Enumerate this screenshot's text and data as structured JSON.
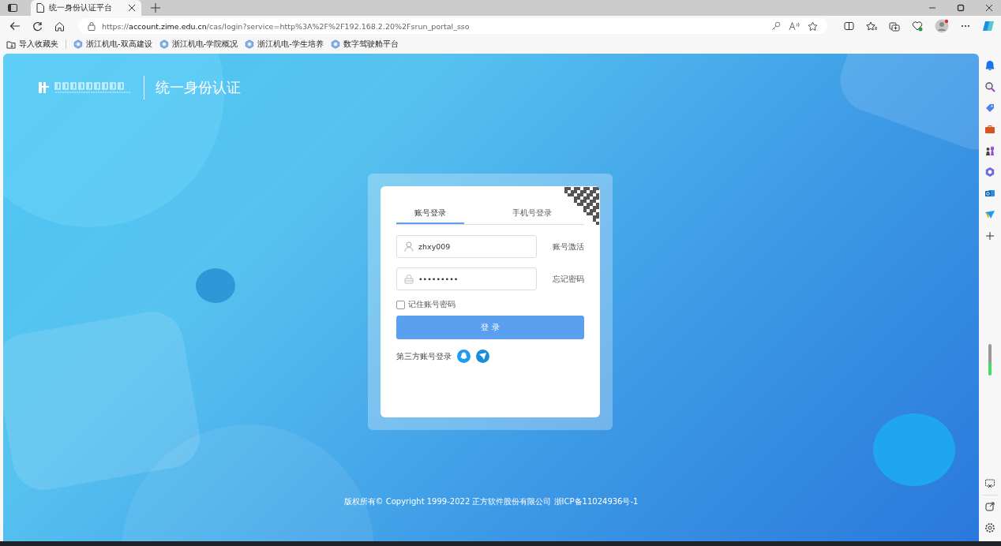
{
  "browser": {
    "tabs": [
      {
        "title": "统一身份认证平台",
        "selected": true
      }
    ],
    "url": {
      "prefix": "https://",
      "host": "account.zime.edu.cn",
      "path": "/cas/login?service=http%3A%2F%2F192.168.2.20%2Fsrun_portal_sso"
    },
    "bookmarks": [
      {
        "label": "导入收藏夹",
        "kind": "import"
      },
      {
        "label": "浙江机电-双高建设",
        "kind": "site"
      },
      {
        "label": "浙江机电-学院概况",
        "kind": "site"
      },
      {
        "label": "浙江机电-学生培养",
        "kind": "site"
      },
      {
        "label": "数字驾驶舱平台",
        "kind": "site"
      }
    ]
  },
  "page": {
    "title": "统一身份认证",
    "login": {
      "tabs": [
        {
          "label": "账号登录",
          "selected": true
        },
        {
          "label": "手机号登录",
          "selected": false
        }
      ],
      "username": {
        "value": "zhxy009",
        "link": "账号激活"
      },
      "password": {
        "value": "•••••••••",
        "link": "忘记密码"
      },
      "remember": {
        "label": "记住账号密码",
        "checked": false
      },
      "submit": "登 录",
      "third_party": {
        "label": "第三方账号登录"
      }
    },
    "footer": "版权所有© Copyright 1999-2022 正方软件股份有限公司 浙ICP备11024936号-1"
  }
}
